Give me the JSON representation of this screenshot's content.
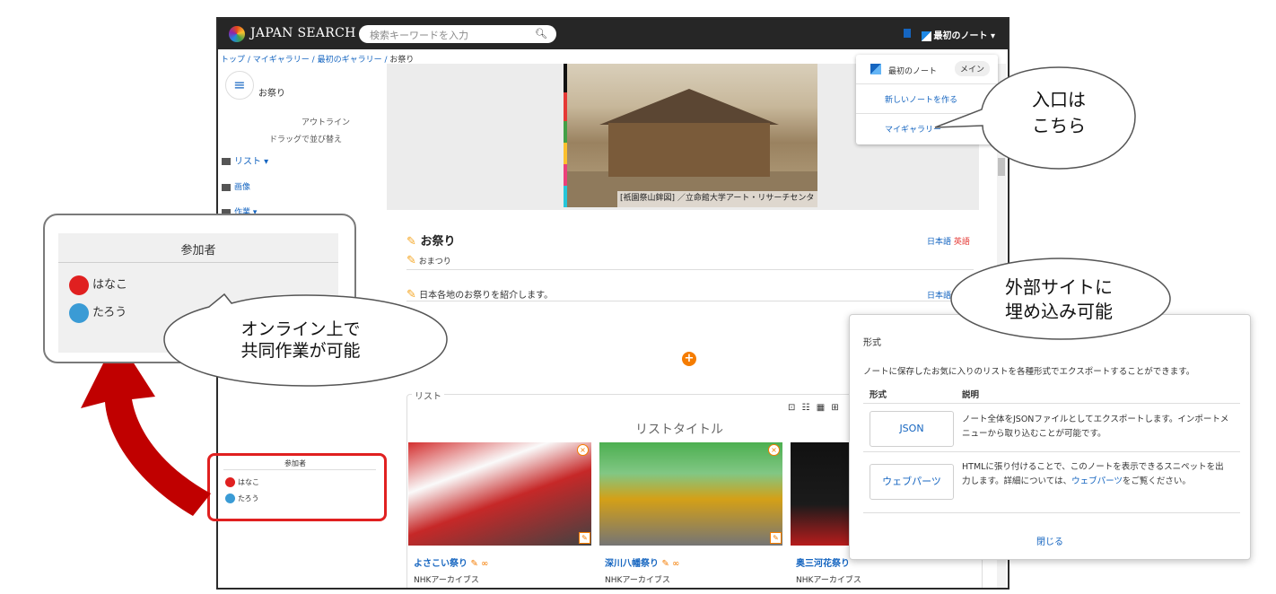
{
  "app": {
    "brand": "JAPAN SEARCH",
    "search_placeholder": "検索キーワードを入力",
    "note_button": "最初のノート ▾"
  },
  "breadcrumb": {
    "items": [
      "トップ",
      "マイギャラリー",
      "最初のギャラリー"
    ],
    "separator": " / ",
    "current": "お祭り"
  },
  "sidebar": {
    "title": "お祭り",
    "outline": "アウトライン",
    "drag_hint": "ドラッグで並び替え",
    "list": "リスト",
    "image": "画像",
    "works": "作業",
    "participants_title": "参加者",
    "participants": [
      {
        "name": "はなこ",
        "color": "#e02020"
      },
      {
        "name": "たろう",
        "color": "#3a9bd5"
      }
    ]
  },
  "hero": {
    "caption": "[祇園祭山鉾図] ／立命館大学アート・リサーチセンター"
  },
  "content": {
    "title": "お祭り",
    "reading": "おまつり",
    "description": "日本各地のお祭りを紹介します。",
    "lang_ja": "日本語",
    "lang_en": "英語",
    "list_legend": "リスト",
    "list_title": "リストタイトル",
    "view_icons": "⊡ ☷ ▦ ⊞",
    "cards": [
      {
        "name": "よさこい祭り",
        "source": "NHKアーカイブス"
      },
      {
        "name": "深川八幡祭り",
        "source": "NHKアーカイブス"
      },
      {
        "name": "奥三河花祭り",
        "source": "NHKアーカイブス"
      }
    ]
  },
  "dropdown": {
    "note": "最初のノート",
    "chip": "メイン",
    "new_note": "新しいノートを作る",
    "my_gallery": "マイギャラリー"
  },
  "participants_popup": {
    "title": "参加者",
    "members": [
      {
        "name": "はなこ",
        "color": "#e02020"
      },
      {
        "name": "たろう",
        "color": "#3a9bd5"
      }
    ]
  },
  "callouts": {
    "collab_line1": "オンライン上で",
    "collab_line2": "共同作業が可能",
    "entry_line1": "入口は",
    "entry_line2": "こちら",
    "embed_line1": "外部サイトに",
    "embed_line2": "埋め込み可能"
  },
  "export_dialog": {
    "title": "形式",
    "description": "ノートに保存したお気に入りのリストを各種形式でエクスポートすることができます。",
    "col_format": "形式",
    "col_desc": "説明",
    "json_label": "JSON",
    "json_desc": "ノート全体をJSONファイルとしてエクスポートします。インポートメニューから取り込むことが可能です。",
    "webparts_label": "ウェブパーツ",
    "webparts_desc_before": "HTMLに張り付けることで、このノートを表示できるスニペットを出力します。詳細については、",
    "webparts_link": "ウェブパーツ",
    "webparts_desc_after": "をご覧ください。",
    "close": "閉じる"
  },
  "colors": {
    "accent": "#1565c0",
    "orange": "#f57c00",
    "highlight_red": "#e02020",
    "arrow_red": "#c00000"
  }
}
